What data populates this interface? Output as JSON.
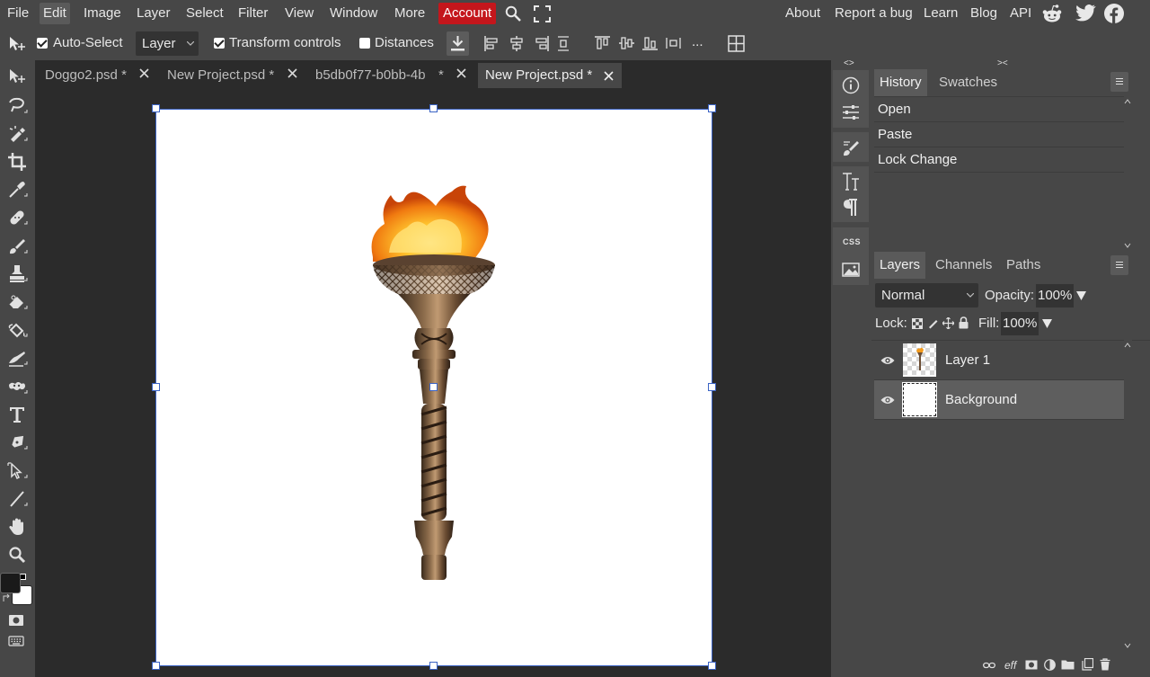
{
  "menu": {
    "items": [
      "File",
      "Edit",
      "Image",
      "Layer",
      "Select",
      "Filter",
      "View",
      "Window",
      "More",
      "Account"
    ],
    "right_links": [
      "About",
      "Report a bug",
      "Learn",
      "Blog",
      "API"
    ]
  },
  "options": {
    "auto_select_label": "Auto-Select",
    "auto_select_checked": true,
    "target_select_value": "Layer",
    "transform_controls_label": "Transform controls",
    "transform_controls_checked": true,
    "distances_label": "Distances",
    "distances_checked": false,
    "more_label": "..."
  },
  "tabs": [
    {
      "name": "Doggo2.psd *",
      "active": false
    },
    {
      "name": "New Project.psd *",
      "active": false
    },
    {
      "name": "b5db0f77-b0bb-4b",
      "suffix": "*",
      "active": false
    },
    {
      "name": "New Project.psd *",
      "active": true
    }
  ],
  "midpanel": {
    "collapse_left": "<>",
    "collapse_right": "><",
    "css_label": "CSS"
  },
  "history_panel": {
    "tabs": [
      "History",
      "Swatches"
    ],
    "items": [
      "Open",
      "Paste",
      "Lock Change"
    ]
  },
  "layers_panel": {
    "tabs": [
      "Layers",
      "Channels",
      "Paths"
    ],
    "blend_mode": "Normal",
    "opacity_label": "Opacity:",
    "opacity_value": "100%",
    "lock_label": "Lock:",
    "fill_label": "Fill:",
    "fill_value": "100%",
    "layers": [
      {
        "name": "Layer 1",
        "visible": true,
        "selected": false
      },
      {
        "name": "Background",
        "visible": true,
        "selected": true
      }
    ],
    "footer_eff_label": "eff"
  },
  "colors": {
    "accent_account": "#c4161c",
    "selection": "#3b63c4",
    "foreground_swatch": "#1a1a1a",
    "background_swatch": "#ffffff"
  }
}
